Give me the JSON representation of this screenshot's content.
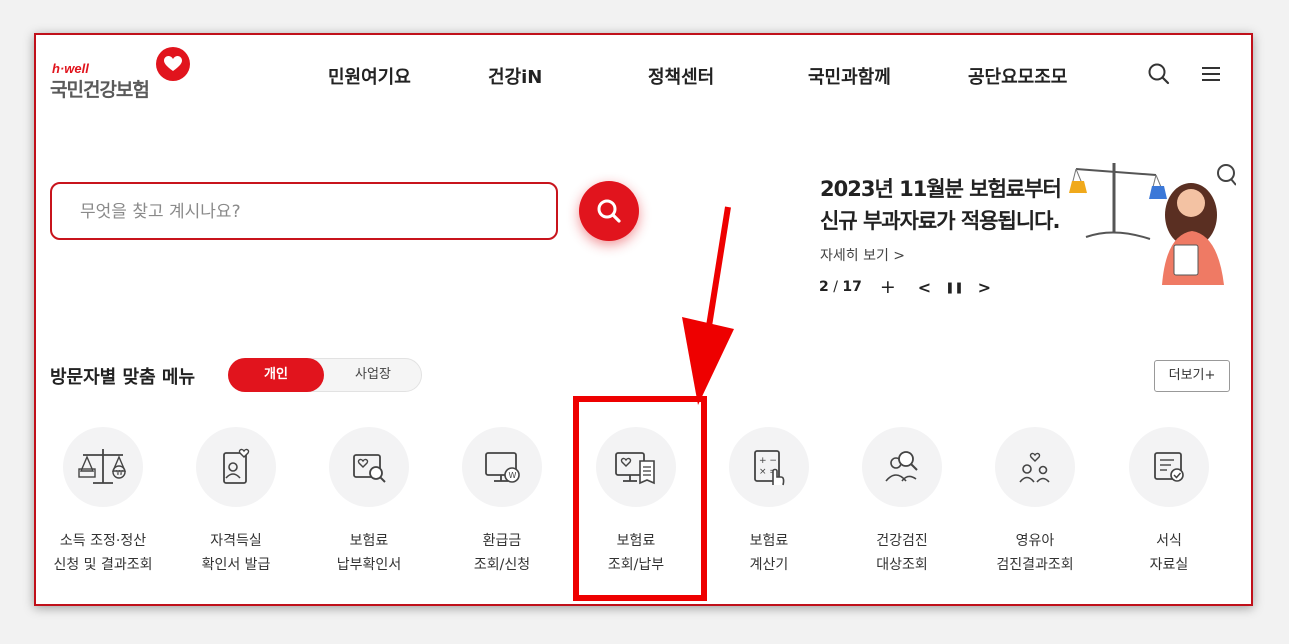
{
  "header": {
    "logo_small": "h·well",
    "logo_main": "국민건강보험",
    "nav": [
      "민원여기요",
      "건강iN",
      "정책센터",
      "국민과함께",
      "공단요모조모"
    ],
    "icons": {
      "search": "search-icon",
      "menu": "hamburger-menu-icon"
    }
  },
  "search": {
    "placeholder": "무엇을 찾고 계시나요?"
  },
  "banner": {
    "line1": "2023년 11월분 보험료부터",
    "line2": "신규 부과자료가 적용됩니다.",
    "more": "자세히 보기 >",
    "page_current": "2",
    "page_sep": " / ",
    "page_total": "17",
    "plus": "+",
    "prev": "<",
    "pause": "❚❚",
    "next": ">"
  },
  "visitor_menu": {
    "title": "방문자별 맞춤 메뉴",
    "tab_personal": "개인",
    "tab_business": "사업장",
    "more": "더보기+"
  },
  "quick_menu": [
    {
      "line1": "소득 조정·정산",
      "line2": "신청 및 결과조회",
      "icon": "scale-icon"
    },
    {
      "line1": "자격득실",
      "line2": "확인서 발급",
      "icon": "id-card-icon"
    },
    {
      "line1": "보험료",
      "line2": "납부확인서",
      "icon": "certificate-search-icon"
    },
    {
      "line1": "환급금",
      "line2": "조회/신청",
      "icon": "monitor-won-icon"
    },
    {
      "line1": "보험료",
      "line2": "조회/납부",
      "icon": "monitor-receipt-icon"
    },
    {
      "line1": "보험료",
      "line2": "계산기",
      "icon": "calculator-icon"
    },
    {
      "line1": "건강검진",
      "line2": "대상조회",
      "icon": "people-search-icon"
    },
    {
      "line1": "영유아",
      "line2": "검진결과조회",
      "icon": "parent-child-icon"
    },
    {
      "line1": "서식",
      "line2": "자료실",
      "icon": "document-check-icon"
    }
  ],
  "colors": {
    "accent": "#e1141d",
    "highlight": "#ee0000"
  }
}
